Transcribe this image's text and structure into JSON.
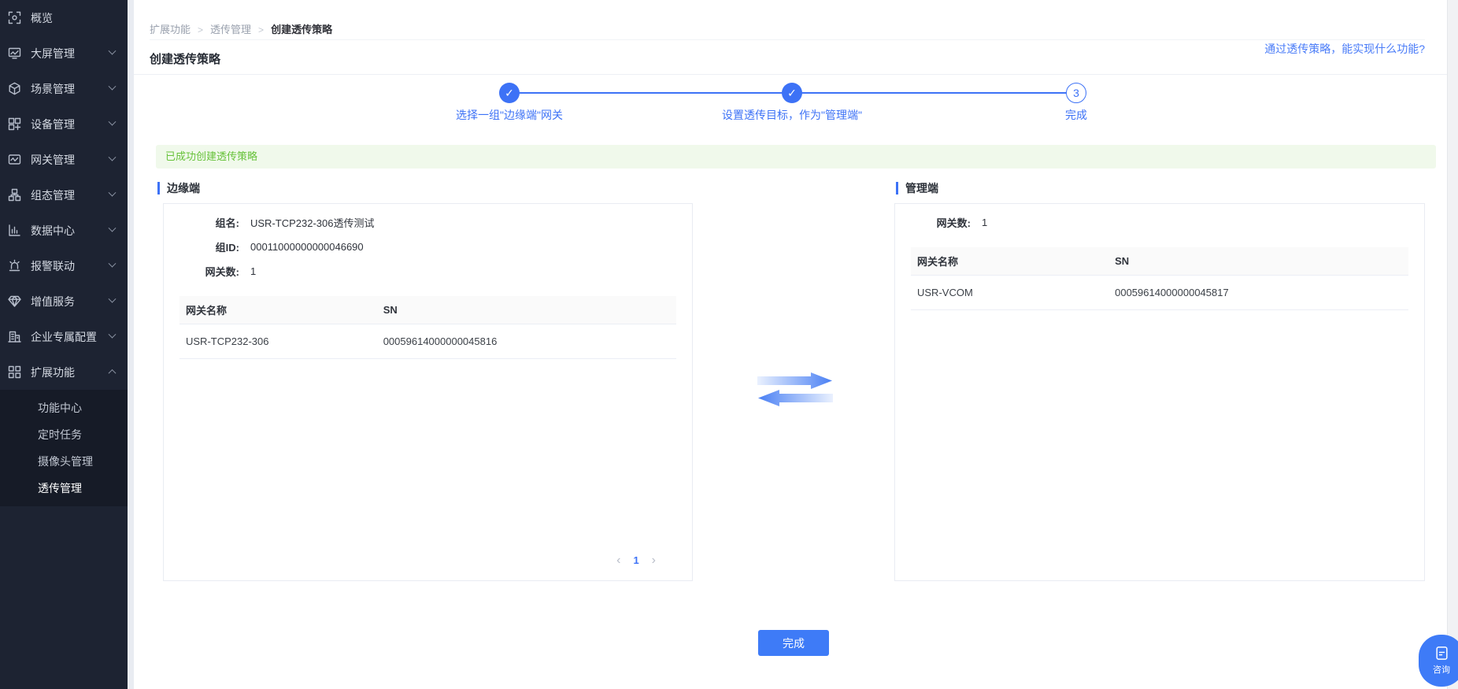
{
  "sidebar": {
    "items": [
      {
        "label": "概览"
      },
      {
        "label": "大屏管理"
      },
      {
        "label": "场景管理"
      },
      {
        "label": "设备管理"
      },
      {
        "label": "网关管理"
      },
      {
        "label": "组态管理"
      },
      {
        "label": "数据中心"
      },
      {
        "label": "报警联动"
      },
      {
        "label": "增值服务"
      },
      {
        "label": "企业专属配置"
      },
      {
        "label": "扩展功能"
      }
    ],
    "submenu": [
      {
        "label": "功能中心"
      },
      {
        "label": "定时任务"
      },
      {
        "label": "摄像头管理"
      },
      {
        "label": "透传管理"
      }
    ]
  },
  "breadcrumb": {
    "separator": ">",
    "items": [
      {
        "label": "扩展功能"
      },
      {
        "label": "透传管理"
      },
      {
        "label": "创建透传策略"
      }
    ]
  },
  "header": {
    "title": "创建透传策略",
    "help_link": "通过透传策略，能实现什么功能?"
  },
  "stepper": {
    "steps": [
      {
        "mark": "✓",
        "label": "选择一组\"边缘端\"网关"
      },
      {
        "mark": "✓",
        "label": "设置透传目标，作为\"管理端\""
      },
      {
        "mark": "3",
        "label": "完成"
      }
    ]
  },
  "alert": {
    "message": "已成功创建透传策略"
  },
  "edge": {
    "title": "边缘端",
    "fields": [
      {
        "label": "组名:",
        "value": "USR-TCP232-306透传测试"
      },
      {
        "label": "组ID:",
        "value": "00011000000000046690"
      },
      {
        "label": "网关数:",
        "value": "1"
      }
    ],
    "table": {
      "col1": "网关名称",
      "col2": "SN",
      "rows": [
        {
          "name": "USR-TCP232-306",
          "sn": "00059614000000045816"
        }
      ]
    },
    "pagination": {
      "prev": "‹",
      "page": "1",
      "next": "›"
    }
  },
  "manage": {
    "title": "管理端",
    "fields": [
      {
        "label": "网关数:",
        "value": "1"
      }
    ],
    "table": {
      "col1": "网关名称",
      "col2": "SN",
      "rows": [
        {
          "name": "USR-VCOM",
          "sn": "00059614000000045817"
        }
      ]
    }
  },
  "footer": {
    "finish": "完成"
  },
  "floating": {
    "label": "咨询"
  },
  "colors": {
    "accent": "#3D72F6",
    "success_text": "#67C23A",
    "success_bg": "#F0F9EB",
    "sidebar_bg": "#1D2332",
    "submenu_bg": "#161B27"
  }
}
